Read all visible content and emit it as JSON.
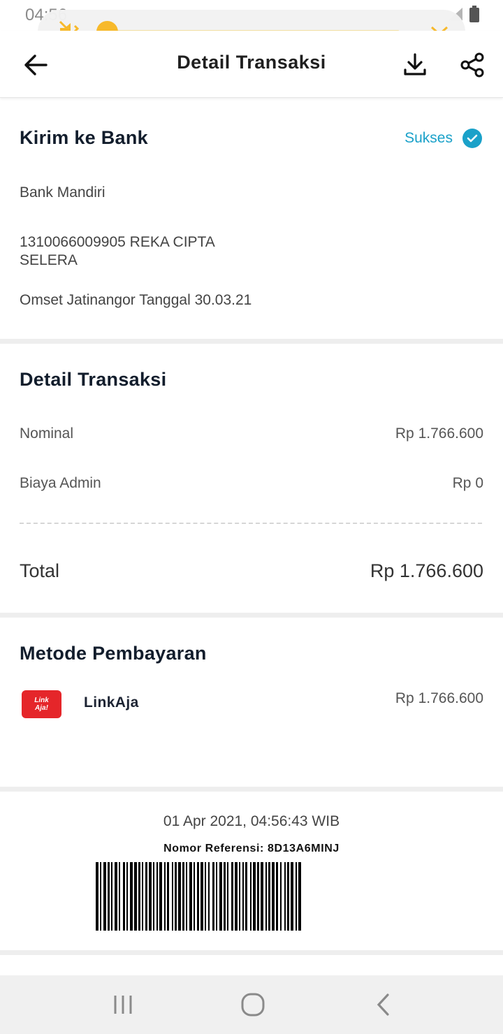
{
  "status_bar": {
    "time": "04:56"
  },
  "volume": {
    "level": 0.0
  },
  "app_bar": {
    "title": "Detail Transaksi"
  },
  "transfer": {
    "title": "Kirim ke Bank",
    "status": "Sukses",
    "bank_name": "Bank Mandiri",
    "account_line1": "1310066009905 REKA CIPTA",
    "account_line2": "SELERA",
    "note": "Omset Jatinangor Tanggal 30.03.21"
  },
  "details": {
    "title": "Detail Transaksi",
    "nominal_label": "Nominal",
    "nominal_value": "Rp 1.766.600",
    "admin_label": "Biaya Admin",
    "admin_value": "Rp 0",
    "total_label": "Total",
    "total_value": "Rp 1.766.600"
  },
  "payment": {
    "title": "Metode Pembayaran",
    "logo_text_1": "Link",
    "logo_text_2": "Aja!",
    "method": "LinkAja",
    "amount": "Rp 1.766.600"
  },
  "footer": {
    "datetime": "01 Apr 2021, 04:56:43 WIB",
    "reference": "Nomor Referensi: 8D13A6MINJ"
  },
  "colors": {
    "accent": "#1aa1c9",
    "volume": "#f7b92b",
    "linkaja": "#e5262a"
  }
}
